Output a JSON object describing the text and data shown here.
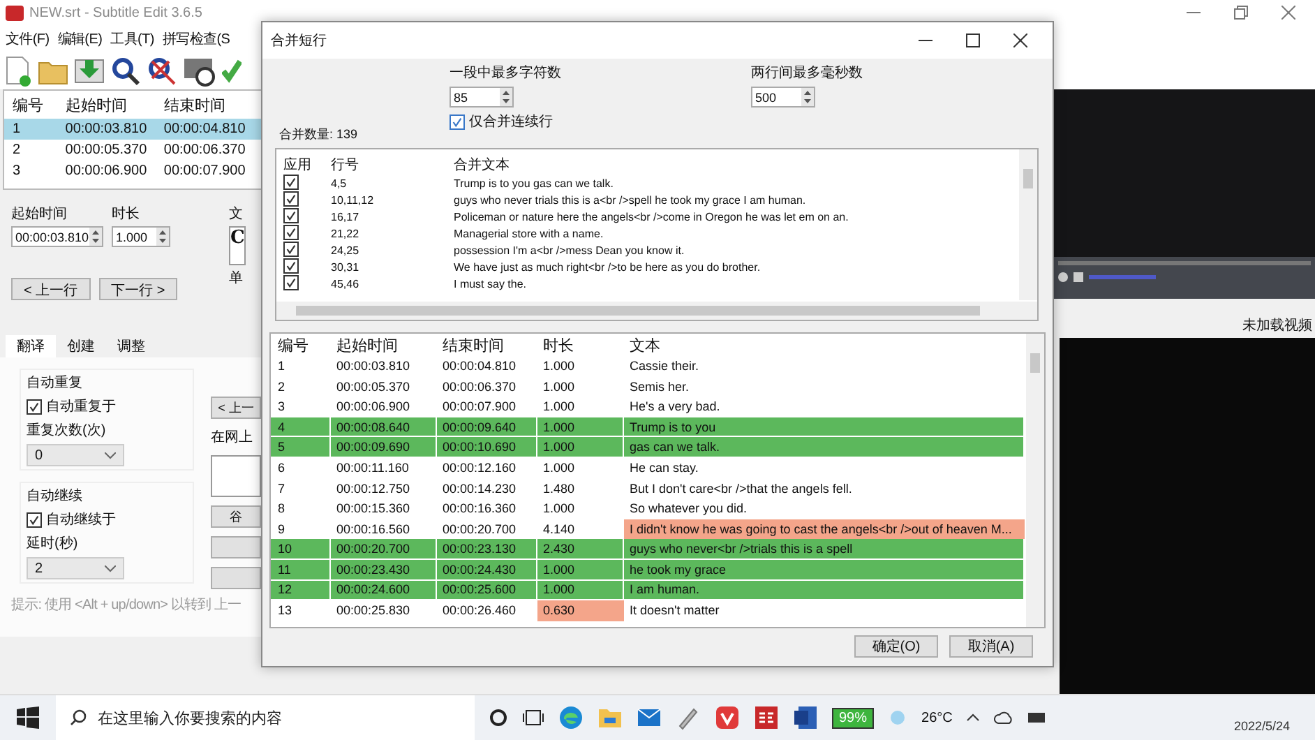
{
  "main_window": {
    "title": "NEW.srt - Subtitle Edit 3.6.5",
    "menu": [
      "文件(F)",
      "编辑(E)",
      "工具(T)",
      "拼写检查(S"
    ],
    "subtitle_list": {
      "columns": [
        "编号",
        "起始时间",
        "结束时间"
      ],
      "rows": [
        {
          "number": "1",
          "start": "00:00:03.810",
          "end": "00:00:04.810",
          "selected": true
        },
        {
          "number": "2",
          "start": "00:00:05.370",
          "end": "00:00:06.370",
          "selected": false
        },
        {
          "number": "3",
          "start": "00:00:06.900",
          "end": "00:00:07.900",
          "selected": false
        }
      ]
    },
    "editor": {
      "start_label": "起始时间",
      "start_value": "00:00:03.810",
      "duration_label": "时长",
      "duration_value": "1.000",
      "text_label": "文",
      "text_preview": "C",
      "single_label": "单",
      "prev_button": "< 上一行",
      "next_button": "下一行 >"
    },
    "tabs": [
      {
        "label": "翻译",
        "selected": true
      },
      {
        "label": "创建",
        "selected": false
      },
      {
        "label": "调整",
        "selected": false
      }
    ],
    "auto_repeat": {
      "title": "自动重复",
      "checkbox": {
        "label": "自动重复于",
        "checked": true
      },
      "field_label": "重复次数(次)",
      "value": "0"
    },
    "auto_continue": {
      "title": "自动继续",
      "checkbox": {
        "label": "自动继续于",
        "checked": true
      },
      "field_label": "延时(秒)",
      "value": "2"
    },
    "hint": "提示: 使用 <Alt + up/down> 以转到 上一",
    "translate_panel": {
      "prev_button": "< 上一",
      "search_label": "在网上",
      "google_button": "谷"
    },
    "video": {
      "status": "未加载视频"
    }
  },
  "dialog": {
    "title": "合并短行",
    "max_chars": {
      "label": "一段中最多字符数",
      "value": "85"
    },
    "max_gap": {
      "label": "两行间最多毫秒数",
      "value": "500"
    },
    "only_consecutive": {
      "label": "仅合并连续行",
      "checked": true
    },
    "merge_count": "合并数量: 139",
    "merge_list": {
      "columns": [
        "应用",
        "行号",
        "合并文本"
      ],
      "rows": [
        {
          "apply": true,
          "lines": "4,5",
          "text": "Trump is to you gas can we talk."
        },
        {
          "apply": true,
          "lines": "10,11,12",
          "text": "guys who never trials this is a<br />spell he took my grace I am human."
        },
        {
          "apply": true,
          "lines": "16,17",
          "text": "Policeman or nature here the angels<br />come in Oregon he was let em on an."
        },
        {
          "apply": true,
          "lines": "21,22",
          "text": "Managerial store with a name."
        },
        {
          "apply": true,
          "lines": "24,25",
          "text": "possession I'm a<br />mess Dean you know it."
        },
        {
          "apply": true,
          "lines": "30,31",
          "text": "We have just as much right<br />to be here as you do brother."
        },
        {
          "apply": true,
          "lines": "45,46",
          "text": "I must say the."
        }
      ]
    },
    "preview": {
      "columns": [
        "编号",
        "起始时间",
        "结束时间",
        "时长",
        "文本"
      ],
      "rows": [
        {
          "number": "1",
          "start": "00:00:03.810",
          "end": "00:00:04.810",
          "duration": "1.000",
          "text": "Cassie their.",
          "merged": false,
          "duration_warning": false,
          "text_warning": false
        },
        {
          "number": "2",
          "start": "00:00:05.370",
          "end": "00:00:06.370",
          "duration": "1.000",
          "text": "Semis her.",
          "merged": false,
          "duration_warning": false,
          "text_warning": false
        },
        {
          "number": "3",
          "start": "00:00:06.900",
          "end": "00:00:07.900",
          "duration": "1.000",
          "text": "He's a very bad.",
          "merged": false,
          "duration_warning": false,
          "text_warning": false
        },
        {
          "number": "4",
          "start": "00:00:08.640",
          "end": "00:00:09.640",
          "duration": "1.000",
          "text": "Trump is to you",
          "merged": true,
          "duration_warning": false,
          "text_warning": false
        },
        {
          "number": "5",
          "start": "00:00:09.690",
          "end": "00:00:10.690",
          "duration": "1.000",
          "text": "gas can we talk.",
          "merged": true,
          "duration_warning": false,
          "text_warning": false
        },
        {
          "number": "6",
          "start": "00:00:11.160",
          "end": "00:00:12.160",
          "duration": "1.000",
          "text": "He can stay.",
          "merged": false,
          "duration_warning": false,
          "text_warning": false
        },
        {
          "number": "7",
          "start": "00:00:12.750",
          "end": "00:00:14.230",
          "duration": "1.480",
          "text": "But I don't care<br />that the angels fell.",
          "merged": false,
          "duration_warning": false,
          "text_warning": false
        },
        {
          "number": "8",
          "start": "00:00:15.360",
          "end": "00:00:16.360",
          "duration": "1.000",
          "text": "So whatever you did.",
          "merged": false,
          "duration_warning": false,
          "text_warning": false
        },
        {
          "number": "9",
          "start": "00:00:16.560",
          "end": "00:00:20.700",
          "duration": "4.140",
          "text": "I didn't know he was going to cast the angels<br />out of heaven M...",
          "merged": false,
          "duration_warning": false,
          "text_warning": true
        },
        {
          "number": "10",
          "start": "00:00:20.700",
          "end": "00:00:23.130",
          "duration": "2.430",
          "text": "guys who never<br />trials this is a spell",
          "merged": true,
          "duration_warning": false,
          "text_warning": false
        },
        {
          "number": "11",
          "start": "00:00:23.430",
          "end": "00:00:24.430",
          "duration": "1.000",
          "text": "he took my grace",
          "merged": true,
          "duration_warning": false,
          "text_warning": false
        },
        {
          "number": "12",
          "start": "00:00:24.600",
          "end": "00:00:25.600",
          "duration": "1.000",
          "text": "I am human.",
          "merged": true,
          "duration_warning": false,
          "text_warning": false
        },
        {
          "number": "13",
          "start": "00:00:25.830",
          "end": "00:00:26.460",
          "duration": "0.630",
          "text": "It doesn't matter",
          "merged": false,
          "duration_warning": true,
          "text_warning": false
        }
      ]
    },
    "buttons": [
      "确定(O)",
      "取消(A)"
    ]
  },
  "taskbar": {
    "search_placeholder": "在这里输入你要搜索的内容",
    "battery": "99%",
    "temperature": "26°C",
    "date": "2022/5/24"
  }
}
